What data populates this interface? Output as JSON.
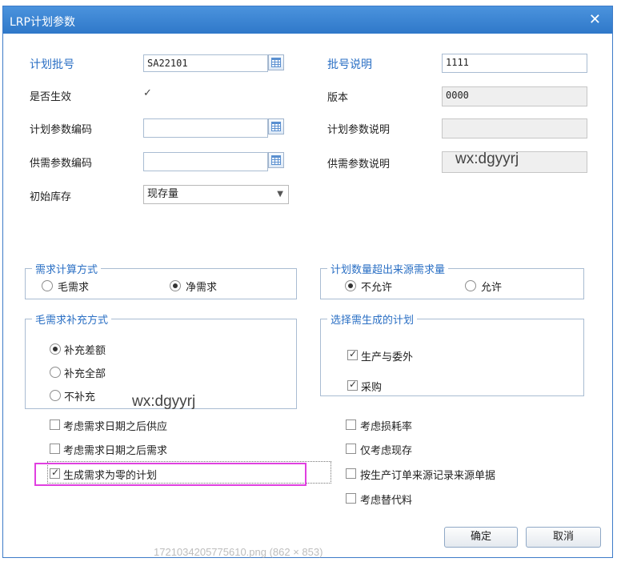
{
  "window": {
    "title": "LRP计划参数",
    "close_glyph": "✕"
  },
  "fields": {
    "plan_batch_label": "计划批号",
    "plan_batch_value": "SA22101",
    "batch_desc_label": "批号说明",
    "batch_desc_value": "1111",
    "effective_label": "是否生效",
    "effective_checked": true,
    "version_label": "版本",
    "version_value": "0000",
    "plan_param_code_label": "计划参数编码",
    "plan_param_code_value": "",
    "plan_param_desc_label": "计划参数说明",
    "plan_param_desc_value": "",
    "supply_param_code_label": "供需参数编码",
    "supply_param_code_value": "",
    "supply_param_desc_label": "供需参数说明",
    "initial_stock_label": "初始库存",
    "initial_stock_value": "现存量"
  },
  "watermark_text": "wx:dgyyrj",
  "groups": {
    "demand_calc": {
      "title": "需求计算方式",
      "options": [
        "毛需求",
        "净需求"
      ],
      "selected": "净需求"
    },
    "over_demand": {
      "title": "计划数量超出来源需求量",
      "options": [
        "不允许",
        "允许"
      ],
      "selected": "不允许"
    },
    "gross_supplement": {
      "title": "毛需求补充方式",
      "options": [
        "补充差额",
        "补充全部",
        "不补充"
      ],
      "selected": "补充差额"
    },
    "plans_to_generate": {
      "title": "选择需生成的计划",
      "options": [
        "生产与委外",
        "采购"
      ],
      "checked": [
        "生产与委外",
        "采购"
      ]
    }
  },
  "options_left": [
    {
      "label": "考虑需求日期之后供应",
      "checked": false
    },
    {
      "label": "考虑需求日期之后需求",
      "checked": false
    },
    {
      "label": "生成需求为零的计划",
      "checked": true
    }
  ],
  "options_right": [
    {
      "label": "考虑损耗率",
      "checked": false
    },
    {
      "label": "仅考虑现存",
      "checked": false
    },
    {
      "label": "按生产订单来源记录来源单据",
      "checked": false
    },
    {
      "label": "考虑替代料",
      "checked": false
    }
  ],
  "buttons": {
    "ok": "确定",
    "cancel": "取消"
  },
  "footer_filename": "17210342057756​10.png (862 × 853)",
  "colors": {
    "title_bar": "#2f78c9",
    "accent_blue": "#2a6fc4",
    "highlight": "#e03fe0"
  }
}
